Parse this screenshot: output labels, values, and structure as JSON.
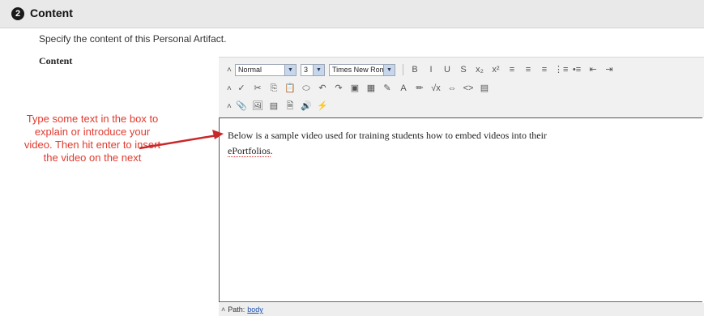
{
  "section": {
    "step_number": "2",
    "title": "Content"
  },
  "instructions": "Specify the content of this Personal Artifact.",
  "field_label": "Content",
  "toolbar": {
    "style_select": "Normal",
    "size_select": "3",
    "font_select": "Times New Roman",
    "row1_buttons": [
      {
        "name": "bold",
        "glyph": "B"
      },
      {
        "name": "italic",
        "glyph": "I"
      },
      {
        "name": "underline",
        "glyph": "U"
      },
      {
        "name": "strikethrough",
        "glyph": "S"
      },
      {
        "name": "subscript",
        "glyph": "x₂"
      },
      {
        "name": "superscript",
        "glyph": "x²"
      },
      {
        "name": "align-left",
        "glyph": "≡"
      },
      {
        "name": "align-center",
        "glyph": "≡"
      },
      {
        "name": "align-right",
        "glyph": "≡"
      },
      {
        "name": "numbered-list",
        "glyph": "⋮≡"
      },
      {
        "name": "bullet-list",
        "glyph": "•≡"
      },
      {
        "name": "outdent",
        "glyph": "⇤"
      },
      {
        "name": "indent",
        "glyph": "⇥"
      }
    ],
    "row2_buttons": [
      {
        "name": "spellcheck",
        "glyph": "✓"
      },
      {
        "name": "cut",
        "glyph": "✂"
      },
      {
        "name": "copy",
        "glyph": "⎘"
      },
      {
        "name": "paste",
        "glyph": "📋"
      },
      {
        "name": "link",
        "glyph": "⬭"
      },
      {
        "name": "undo",
        "glyph": "↶"
      },
      {
        "name": "redo",
        "glyph": "↷"
      },
      {
        "name": "image",
        "glyph": "▣"
      },
      {
        "name": "table",
        "glyph": "▦"
      },
      {
        "name": "pencil",
        "glyph": "✎"
      },
      {
        "name": "text-color",
        "glyph": "A"
      },
      {
        "name": "highlight",
        "glyph": "✏"
      },
      {
        "name": "math",
        "glyph": "√x"
      },
      {
        "name": "media",
        "glyph": "⇔"
      },
      {
        "name": "html-source",
        "glyph": "<>"
      },
      {
        "name": "preview",
        "glyph": "▤"
      }
    ],
    "row3_buttons": [
      {
        "name": "attach-file",
        "glyph": "📎"
      },
      {
        "name": "insert-image",
        "glyph": "🖼"
      },
      {
        "name": "insert-media",
        "glyph": "▤"
      },
      {
        "name": "insert-document",
        "glyph": "🗎"
      },
      {
        "name": "insert-audio",
        "glyph": "🔊"
      },
      {
        "name": "insert-mashup",
        "glyph": "⚡"
      }
    ]
  },
  "editor": {
    "text_part1": "Below is a sample video used for training students how to embed videos into their",
    "text_part2": "ePortfolios",
    "text_end": "."
  },
  "statusbar": {
    "path_label": "Path:",
    "path_value": "body"
  },
  "annotation": {
    "text": "Type some text in the box to explain or introduce your video.  Then hit enter to insert the video on the next",
    "color": "#e03a2e"
  }
}
